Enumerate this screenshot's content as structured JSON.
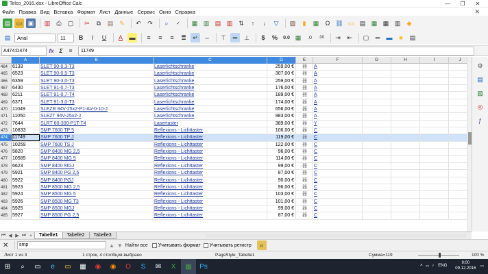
{
  "window": {
    "title": "Telco_2016.xlsx - LibreOffice Calc",
    "min": "—",
    "max": "❐",
    "close": "✕"
  },
  "menu": [
    "Файл",
    "Правка",
    "Вид",
    "Вставка",
    "Формат",
    "Лист",
    "Данные",
    "Сервис",
    "Окно",
    "Справка"
  ],
  "toolbar": {
    "font_name": "Arial",
    "font_size": "11",
    "currency": "$",
    "percent": "%",
    "number": "0.0",
    "decimals_add": ".0",
    "decimals_remove": ".00",
    "omega": "Ω"
  },
  "formula_bar": {
    "name_box": "A474:D474",
    "content": "11749",
    "fx": "fx",
    "sigma": "Σ",
    "equals": "="
  },
  "columns": [
    "A",
    "B",
    "C",
    "D",
    "E",
    "F",
    "G",
    "H",
    "I",
    "J"
  ],
  "rows": [
    {
      "n": "464",
      "a": "6133",
      "b": "SLET 90-0,3-T3",
      "c": "Laserlichtschranke",
      "d": "259,00 €",
      "e": "器",
      "f": "A"
    },
    {
      "n": "465",
      "a": "6523",
      "b": "SLET 90-0,5-T3",
      "c": "Laserlichtschranke",
      "d": "307,00 €",
      "e": "器",
      "f": "A"
    },
    {
      "n": "466",
      "a": "6359",
      "b": "SLET 90-3,0-T3",
      "c": "Laserlichtschranke",
      "d": "259,00 €",
      "e": "器",
      "f": "A"
    },
    {
      "n": "467",
      "a": "6430",
      "b": "SLET 91-0,7-T3",
      "c": "Laserlichtschranke",
      "d": "176,00 €",
      "e": "器",
      "f": "A"
    },
    {
      "n": "468",
      "a": "6211",
      "b": "SLET 91-0,7-T4",
      "c": "Laserlichtschranke",
      "d": "189,00 €",
      "e": "器",
      "f": "A"
    },
    {
      "n": "469",
      "a": "6371",
      "b": "SLET 91-3,0-T3",
      "c": "Laserlichtschranke",
      "d": "174,00 €",
      "e": "器",
      "f": "A"
    },
    {
      "n": "470",
      "a": "11049",
      "b": "SLEZR 94V-25x2-P1-AV-0-10-J",
      "c": "Laserlichtschranke",
      "d": "656,00 €",
      "e": "器",
      "f": "A"
    },
    {
      "n": "471",
      "a": "11050",
      "b": "SLEZT 94V-25x2-J",
      "c": "Laserlichtschranke",
      "d": "983,00 €",
      "e": "器",
      "f": "A"
    },
    {
      "n": "472",
      "a": "7644",
      "b": "SLRT 60-300-P1T-T4",
      "c": "Lasertaster",
      "d": "389,00 €",
      "e": "器",
      "f": "Y"
    },
    {
      "n": "473",
      "a": "10833",
      "b": "SMP 7600 TP 5",
      "c": "Reflexions - Lichttaster",
      "d": "106,00 €",
      "e": "器",
      "f": "C"
    },
    {
      "n": "474",
      "a": "11749",
      "b": "SMP 7600 TP J",
      "c": "Reflexions - Lichttaster",
      "d": "119,00 €",
      "e": "器",
      "f": "C",
      "selected": true
    },
    {
      "n": "475",
      "a": "10259",
      "b": "SMP 7600 TS J",
      "c": "Reflexions - Lichttaster",
      "d": "122,00 €",
      "e": "器",
      "f": "C"
    },
    {
      "n": "476",
      "a": "5820",
      "b": "SMP 8400 MG 2,5",
      "c": "Reflexions - Lichttaster",
      "d": "96,00 €",
      "e": "器",
      "f": "C"
    },
    {
      "n": "477",
      "a": "10585",
      "b": "SMP 8400 MG 5",
      "c": "Reflexions - Lichttaster",
      "d": "114,00 €",
      "e": "器",
      "f": "C"
    },
    {
      "n": "478",
      "a": "6623",
      "b": "SMP 8400 MGJ",
      "c": "Reflexions - Lichttaster",
      "d": "99,00 €",
      "e": "器",
      "f": "C"
    },
    {
      "n": "479",
      "a": "5921",
      "b": "SMP 8400 PG 2,5",
      "c": "Reflexions - Lichttaster",
      "d": "87,00 €",
      "e": "器",
      "f": "C"
    },
    {
      "n": "480",
      "a": "5922",
      "b": "SMP 8400 PGJ",
      "c": "Reflexions - Lichttaster",
      "d": "90,00 €",
      "e": "器",
      "f": "C"
    },
    {
      "n": "481",
      "a": "5923",
      "b": "SMP 8500 MG 2,5",
      "c": "Reflexions - Lichttaster",
      "d": "96,00 €",
      "e": "器",
      "f": "C"
    },
    {
      "n": "482",
      "a": "5924",
      "b": "SMP 8500 MG 5",
      "c": "Reflexions - Lichttaster",
      "d": "103,00 €",
      "e": "器",
      "f": "C"
    },
    {
      "n": "483",
      "a": "5926",
      "b": "SMP 8500 MG T3",
      "c": "Reflexions - Lichttaster",
      "d": "101,00 €",
      "e": "器",
      "f": "C"
    },
    {
      "n": "484",
      "a": "5925",
      "b": "SMP 8500 MGJ",
      "c": "Reflexions - Lichttaster",
      "d": "99,00 €",
      "e": "器",
      "f": "C"
    },
    {
      "n": "485",
      "a": "5927",
      "b": "SMP 8500 PG 2,5",
      "c": "Reflexions - Lichttaster",
      "d": "87,00 €",
      "e": "器",
      "f": "C"
    }
  ],
  "tabs": [
    "Tabelle1",
    "Tabelle2",
    "Tabelle3"
  ],
  "findbar": {
    "query": "smp",
    "find_all": "Найти все",
    "match_format": "Учитывать формат",
    "match_case": "Учитывать регистр"
  },
  "status": {
    "sheet": "Лист 1 из 3",
    "selection": "1 строк, 4 столбцов выбрано",
    "page_style": "PageStyle_Tabelle1",
    "sum": "Сумма=119",
    "zoom": "100 %"
  },
  "taskbar": {
    "lang": "ENG",
    "time": "9:00",
    "date": "09.12.2016"
  }
}
